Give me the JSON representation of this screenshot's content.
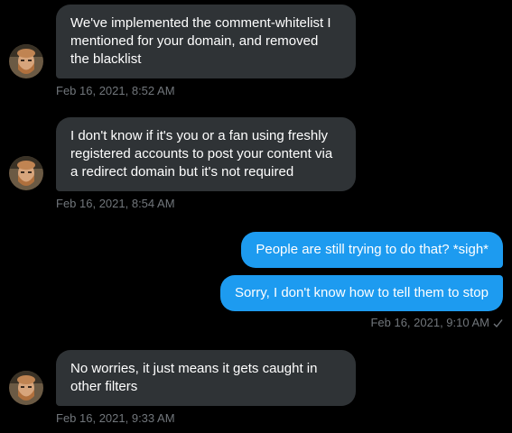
{
  "colors": {
    "background": "#000000",
    "incoming_bubble": "#2f3336",
    "outgoing_bubble": "#1d9bf0",
    "timestamp": "#71767b"
  },
  "messages": [
    {
      "direction": "incoming",
      "text": "We've implemented the comment-whitelist I\nmentioned for your domain, and removed\nthe blacklist",
      "timestamp": "Feb 16, 2021, 8:52 AM",
      "avatar_icon": "user-avatar-icon"
    },
    {
      "direction": "incoming",
      "text": "I don't know if it's you or a fan using freshly\nregistered accounts to post your content via\na redirect domain but it's not required",
      "timestamp": "Feb 16, 2021, 8:54 AM",
      "avatar_icon": "user-avatar-icon"
    },
    {
      "direction": "outgoing",
      "text": "People are still trying to do that? *sigh*"
    },
    {
      "direction": "outgoing",
      "text": "Sorry, I don't know how to tell them to stop",
      "timestamp": "Feb 16, 2021, 9:10 AM",
      "status_icon": "checkmark-icon"
    },
    {
      "direction": "incoming",
      "text": "No worries, it just means it gets caught in\nother filters",
      "timestamp": "Feb 16, 2021, 9:33 AM",
      "avatar_icon": "user-avatar-icon"
    }
  ]
}
